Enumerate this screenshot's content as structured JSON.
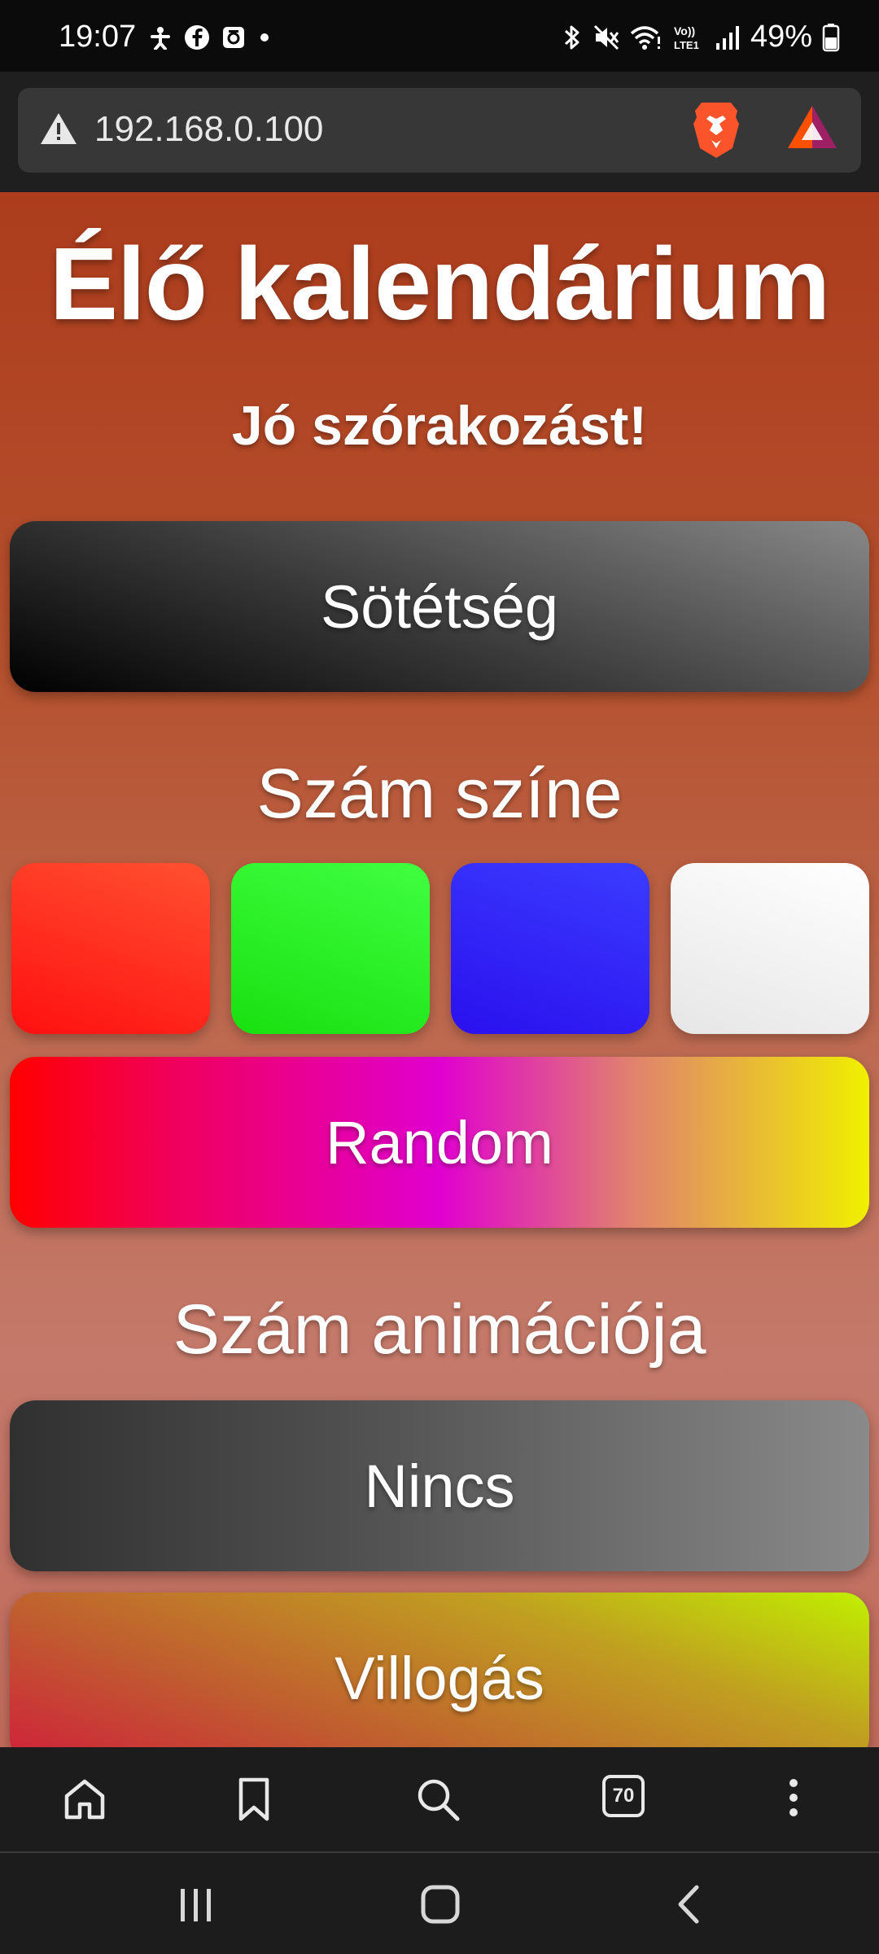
{
  "status_bar": {
    "time": "19:07",
    "battery_percent": "49%",
    "left_icons": [
      "accessibility-icon",
      "facebook-icon",
      "app-notification-icon",
      "dot-icon"
    ],
    "right_icons": [
      "bluetooth-icon",
      "mute-icon",
      "wifi-icon",
      "volte-icon",
      "signal-icon",
      "battery-icon"
    ]
  },
  "browser": {
    "url": "192.168.0.100",
    "security_icon": "warning-icon",
    "shields_icon": "brave-lion-icon",
    "rewards_icon": "bat-triangle-icon",
    "tab_count": "70"
  },
  "page": {
    "title": "Élő kalendárium",
    "subtitle": "Jó szórakozást!",
    "darkness_button": "Sötétség",
    "color_heading": "Szám színe",
    "color_swatches": [
      {
        "name": "red",
        "color": "#ff2a1a"
      },
      {
        "name": "green",
        "color": "#2cf02a"
      },
      {
        "name": "blue",
        "color": "#3020f5"
      },
      {
        "name": "white",
        "color": "#f4f4f4"
      }
    ],
    "random_button": "Random",
    "animation_heading": "Szám animációja",
    "animation_buttons": [
      "Nincs",
      "Villogás"
    ]
  },
  "colors": {
    "page_background_top": "#ac3c1c",
    "page_background_bottom": "#c4796a",
    "browser_chrome": "#1c1c1c"
  }
}
